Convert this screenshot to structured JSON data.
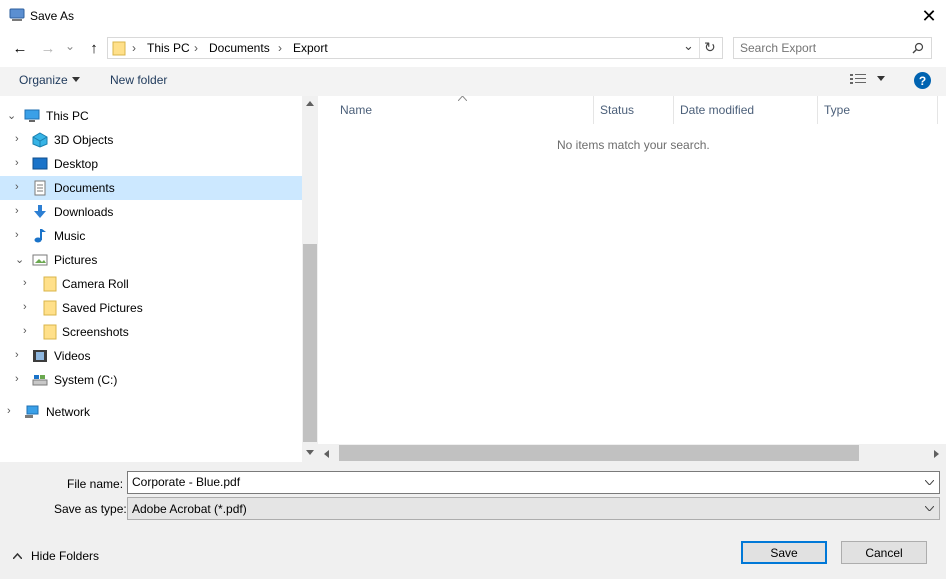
{
  "window": {
    "title": "Save As",
    "close_glyph": "✕"
  },
  "nav": {
    "back_glyph": "←",
    "forward_glyph": "→",
    "recent_glyph": "⌄",
    "up_glyph": "↑",
    "breadcrumb": [
      {
        "label": "This PC"
      },
      {
        "label": "Documents"
      },
      {
        "label": "Export"
      }
    ],
    "separator": "›",
    "dropdown_glyph": "⌄",
    "refresh_glyph": "↻"
  },
  "search": {
    "placeholder": "Search Export",
    "icon": "search-icon"
  },
  "toolbar": {
    "organize_label": "Organize",
    "new_folder_label": "New folder",
    "view_icon": "details-view-icon",
    "help_glyph": "?"
  },
  "tree": {
    "items": [
      {
        "label": "This PC",
        "icon": "computer-icon",
        "expanded": true
      },
      {
        "label": "3D Objects",
        "icon": "3d-objects-icon",
        "expanded": false
      },
      {
        "label": "Desktop",
        "icon": "desktop-icon",
        "expanded": false
      },
      {
        "label": "Documents",
        "icon": "documents-icon",
        "expanded": false,
        "selected": true
      },
      {
        "label": "Downloads",
        "icon": "downloads-icon",
        "expanded": false
      },
      {
        "label": "Music",
        "icon": "music-icon",
        "expanded": false
      },
      {
        "label": "Pictures",
        "icon": "pictures-icon",
        "expanded": true
      },
      {
        "label": "Camera Roll",
        "icon": "folder-icon",
        "expanded": false
      },
      {
        "label": "Saved Pictures",
        "icon": "folder-icon",
        "expanded": false
      },
      {
        "label": "Screenshots",
        "icon": "folder-icon",
        "expanded": false
      },
      {
        "label": "Videos",
        "icon": "videos-icon",
        "expanded": false
      },
      {
        "label": "System (C:)",
        "icon": "drive-icon",
        "expanded": false
      },
      {
        "label": "Network",
        "icon": "network-icon",
        "expanded": false
      }
    ]
  },
  "content": {
    "columns": [
      {
        "label": "Name"
      },
      {
        "label": "Status"
      },
      {
        "label": "Date modified"
      },
      {
        "label": "Type"
      }
    ],
    "empty_message": "No items match your search."
  },
  "form": {
    "file_name_label": "File name:",
    "file_name_value": "Corporate - Blue.pdf",
    "save_type_label": "Save as type:",
    "save_type_value": "Adobe Acrobat (*.pdf)"
  },
  "footer": {
    "hide_folders_label": "Hide Folders",
    "save_label": "Save",
    "cancel_label": "Cancel"
  },
  "colors": {
    "selection": "#cce8ff",
    "accent": "#0078d7",
    "folder": "#ffe08a"
  }
}
